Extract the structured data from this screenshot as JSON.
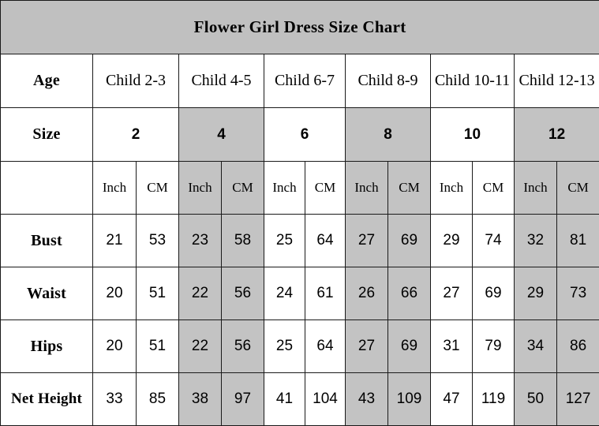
{
  "chart": {
    "title": "Flower Girl Dress Size Chart",
    "row_labels": {
      "age": "Age",
      "size": "Size",
      "units_blank": "",
      "bust": "Bust",
      "waist": "Waist",
      "hips": "Hips",
      "net_height": "Net Height"
    },
    "colors": {
      "header_gray": "#c0c0c0",
      "shaded_gray": "#c3c3c3",
      "background": "#ffffff",
      "border": "#1a1a1a",
      "text": "#000000"
    },
    "columns": [
      {
        "age": "Child 2-3",
        "size": "2",
        "shaded": false,
        "units": [
          "Inch",
          "CM"
        ]
      },
      {
        "age": "Child 4-5",
        "size": "4",
        "shaded": true,
        "units": [
          "Inch",
          "CM"
        ]
      },
      {
        "age": "Child 6-7",
        "size": "6",
        "shaded": false,
        "units": [
          "Inch",
          "CM"
        ]
      },
      {
        "age": "Child 8-9",
        "size": "8",
        "shaded": true,
        "units": [
          "Inch",
          "CM"
        ]
      },
      {
        "age": "Child 10-11",
        "size": "10",
        "shaded": false,
        "units": [
          "Inch",
          "CM"
        ]
      },
      {
        "age": "Child 12-13",
        "size": "12",
        "shaded": true,
        "units": [
          "Inch",
          "CM"
        ]
      }
    ],
    "measurements": [
      {
        "label": "Bust",
        "values": [
          "21",
          "53",
          "23",
          "58",
          "25",
          "64",
          "27",
          "69",
          "29",
          "74",
          "32",
          "81"
        ]
      },
      {
        "label": "Waist",
        "values": [
          "20",
          "51",
          "22",
          "56",
          "24",
          "61",
          "26",
          "66",
          "27",
          "69",
          "29",
          "73"
        ]
      },
      {
        "label": "Hips",
        "values": [
          "20",
          "51",
          "22",
          "56",
          "25",
          "64",
          "27",
          "69",
          "31",
          "79",
          "34",
          "86"
        ]
      },
      {
        "label": "Net Height",
        "values": [
          "33",
          "85",
          "38",
          "97",
          "41",
          "104",
          "43",
          "109",
          "47",
          "119",
          "50",
          "127"
        ]
      }
    ]
  }
}
